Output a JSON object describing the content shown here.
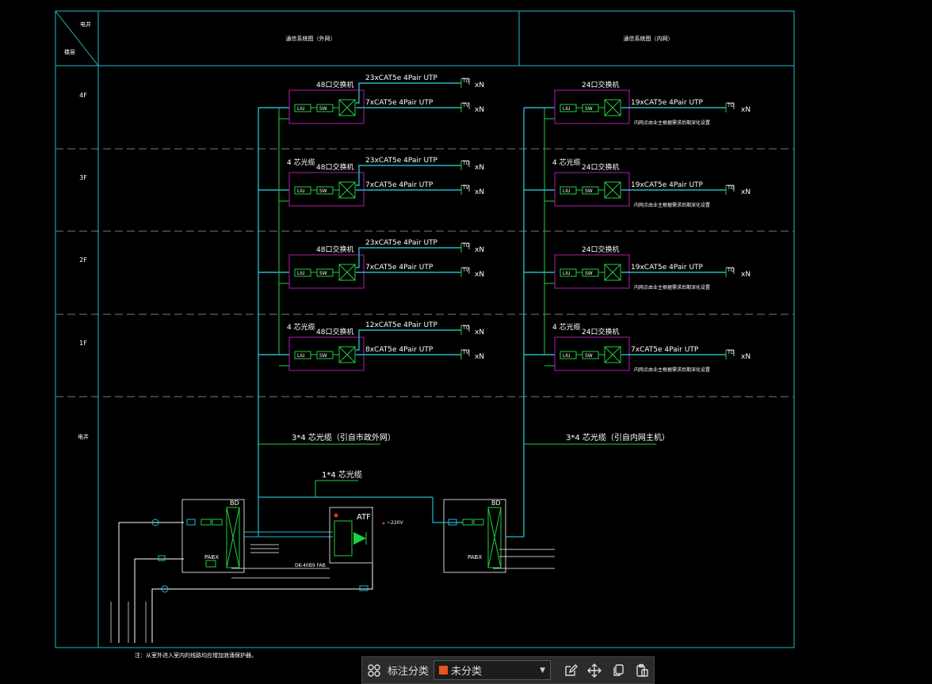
{
  "header": {
    "corner_top": "电井",
    "corner_bottom": "楼层",
    "outer_title": "通信系统图（外网）",
    "inner_title": "通信系统图（内网）"
  },
  "floors": [
    "4F",
    "3F",
    "2F",
    "1F",
    "电井"
  ],
  "left": [
    {
      "switch": "48口交换机",
      "fiber": "",
      "l1": "23xCAT5e 4Pair UTP",
      "l2": "7xCAT5e 4Pair UTP"
    },
    {
      "switch": "48口交换机",
      "fiber": "4 芯光缆",
      "l1": "23xCAT5e 4Pair UTP",
      "l2": "7xCAT5e 4Pair UTP"
    },
    {
      "switch": "48口交换机",
      "fiber": "",
      "l1": "23xCAT5e 4Pair UTP",
      "l2": "7xCAT5e 4Pair UTP"
    },
    {
      "switch": "48口交换机",
      "fiber": "4 芯光缆",
      "l1": "12xCAT5e 4Pair UTP",
      "l2": "8xCAT5e 4Pair UTP"
    }
  ],
  "right": [
    {
      "switch": "24口交换机",
      "fiber": "",
      "l1": "19xCAT5e 4Pair UTP",
      "note": "内网点由业主根据需求后期深化设置"
    },
    {
      "switch": "24口交换机",
      "fiber": "4 芯光缆",
      "l1": "19xCAT5e 4Pair UTP",
      "note": "内网点由业主根据需求后期深化设置"
    },
    {
      "switch": "24口交换机",
      "fiber": "",
      "l1": "19xCAT5e 4Pair UTP",
      "note": "内网点由业主根据需求后期深化设置"
    },
    {
      "switch": "24口交换机",
      "fiber": "4 芯光缆",
      "l1": "7xCAT5e 4Pair UTP",
      "note": "内网点由业主根据需求后期深化设置"
    }
  ],
  "labels": {
    "liu": "LIU",
    "sw": "SW",
    "to": "TO",
    "tv": "TV",
    "xn": "xN",
    "trunk_outer": "3*4 芯光缆（引自市政外网）",
    "trunk_inner": "3*4 芯光缆（引自内网主机）",
    "link": "1*4 芯光缆",
    "bd": "BD",
    "atf": "ATF",
    "pabx": "PABX",
    "v220": "~220V",
    "cable_note": "DK-40B9 FAB",
    "note": "注：从室外进入室内的线路均应增加浪涌保护器。"
  },
  "toolbar": {
    "label": "标注分类",
    "value": "未分类",
    "swatch": "#e8541e"
  },
  "colors": {
    "frame": "#20b8c8",
    "box": "#b01eb0",
    "green": "#20d040",
    "text": "#ffffff",
    "dash": "#7a7a7a"
  }
}
